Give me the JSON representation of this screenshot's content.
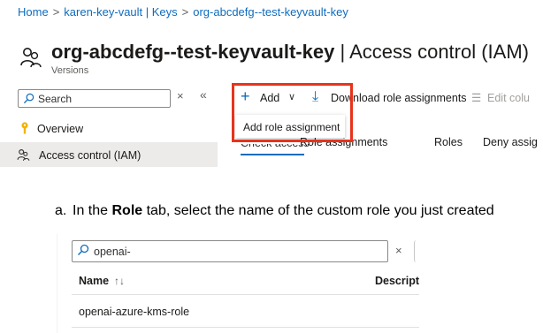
{
  "breadcrumb": {
    "home": "Home",
    "vault": "karen-key-vault | Keys",
    "key": "org-abcdefg--test-keyvault-key"
  },
  "header": {
    "resource_name": "org-abcdefg--test-keyvault-key",
    "separator": "|",
    "section": "Access control (IAM)",
    "subtitle": "Versions"
  },
  "sidebar": {
    "search_placeholder": "Search",
    "clear_label": "×",
    "collapse_label": "«",
    "items": [
      {
        "label": "Overview",
        "icon": "key-icon"
      },
      {
        "label": "Access control (IAM)",
        "icon": "people-icon",
        "selected": true
      }
    ]
  },
  "toolbar": {
    "add_label": "Add",
    "download_label": "Download role assignments",
    "edit_columns_label": "Edit colu"
  },
  "add_menu": {
    "items": [
      "Add role assignment"
    ]
  },
  "tabs": [
    {
      "label": "Check access",
      "active": true
    },
    {
      "label": "Role assignments"
    },
    {
      "label": "Roles"
    },
    {
      "label": "Deny assig"
    }
  ],
  "instruction": {
    "marker": "a.",
    "prefix": "In the ",
    "bold": "Role",
    "suffix": " tab, select the name of the custom role you just created"
  },
  "role_panel": {
    "search_value": "openai-",
    "clear_label": "×",
    "columns": [
      "Name",
      "Descripti"
    ],
    "sort_indicator": "↑↓",
    "rows": [
      {
        "name": "openai-azure-kms-role"
      }
    ]
  },
  "colors": {
    "accent": "#0f6cbd",
    "highlight": "#e8331c",
    "selected_bg": "#edebe9"
  }
}
